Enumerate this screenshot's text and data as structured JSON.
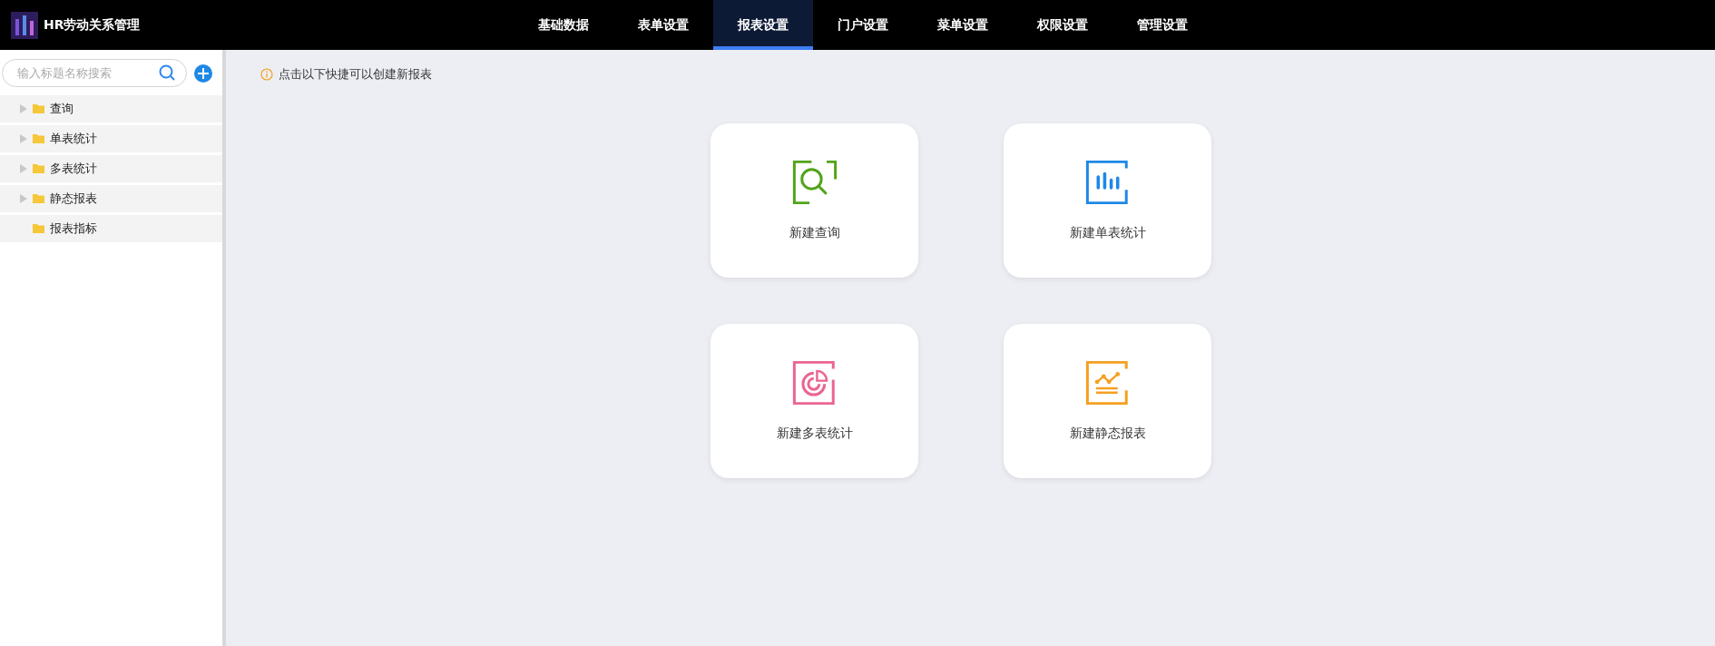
{
  "app": {
    "title": "HR劳动关系管理"
  },
  "nav": [
    {
      "label": "基础数据",
      "selected": false
    },
    {
      "label": "表单设置",
      "selected": false
    },
    {
      "label": "报表设置",
      "selected": true
    },
    {
      "label": "门户设置",
      "selected": false
    },
    {
      "label": "菜单设置",
      "selected": false
    },
    {
      "label": "权限设置",
      "selected": false
    },
    {
      "label": "管理设置",
      "selected": false
    }
  ],
  "sidebar": {
    "search": {
      "placeholder": "输入标题名称搜索"
    },
    "tree": [
      {
        "label": "查询",
        "expandable": true
      },
      {
        "label": "单表统计",
        "expandable": true
      },
      {
        "label": "多表统计",
        "expandable": true
      },
      {
        "label": "静态报表",
        "expandable": true
      },
      {
        "label": "报表指标",
        "expandable": false
      }
    ]
  },
  "notice": "点击以下快捷可以创建新报表",
  "cards": [
    {
      "kind": "query",
      "label": "新建查询",
      "color": "#52a41a"
    },
    {
      "kind": "bar",
      "label": "新建单表统计",
      "color": "#1e88e5"
    },
    {
      "kind": "pie",
      "label": "新建多表统计",
      "color": "#eb6592"
    },
    {
      "kind": "line",
      "label": "新建静态报表",
      "color": "#f5a01f"
    }
  ]
}
